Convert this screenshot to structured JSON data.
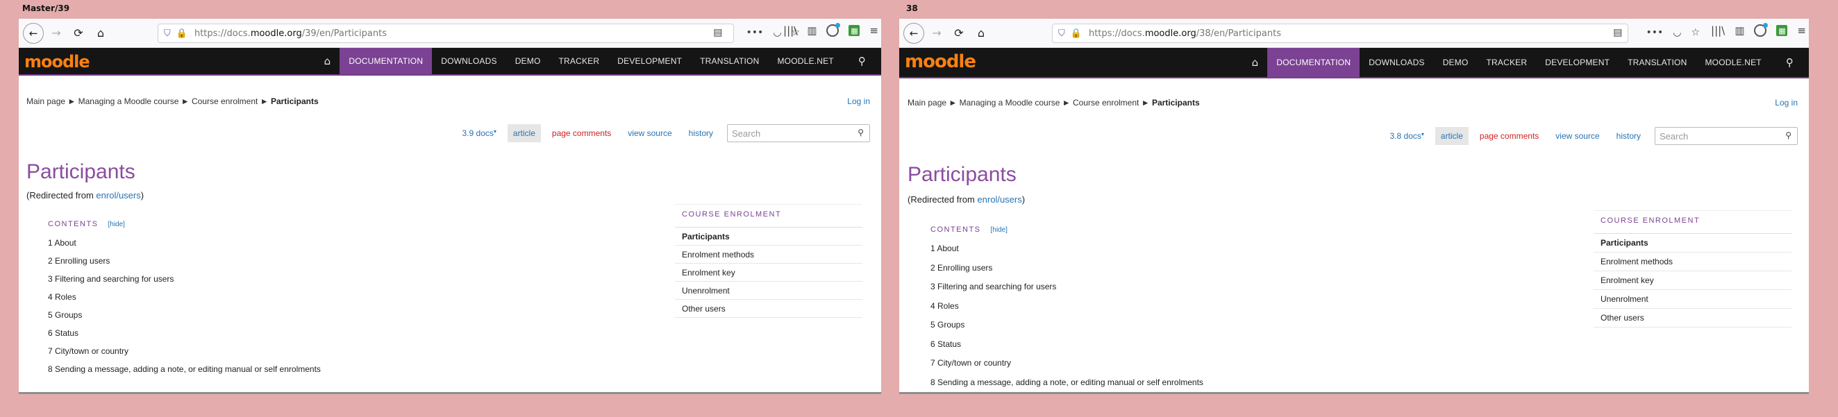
{
  "panels": [
    {
      "label": "Master/39",
      "url_prefix": "https://docs.",
      "url_domain": "moodle.org",
      "url_path": "/39/en/Participants",
      "version_label": "3.9 docs",
      "caret": "▾"
    },
    {
      "label": "38",
      "url_prefix": "https://docs.",
      "url_domain": "moodle.org",
      "url_path": "/38/en/Participants",
      "version_label": "3.8 docs",
      "caret": "▾"
    }
  ],
  "logo": "moodle",
  "nav": [
    "DOCUMENTATION",
    "DOWNLOADS",
    "DEMO",
    "TRACKER",
    "DEVELOPMENT",
    "TRANSLATION",
    "MOODLE.NET"
  ],
  "breadcrumb": {
    "main": "Main page",
    "sep": "►",
    "course": "Managing a Moodle course",
    "enrol": "Course enrolment",
    "current": "Participants"
  },
  "login": "Log in",
  "tabs": {
    "article": "article",
    "comments": "page comments",
    "source": "view source",
    "history": "history"
  },
  "search_placeholder": "Search",
  "page_title": "Participants",
  "redirect": {
    "prefix": "(Redirected from ",
    "link": "enrol/users",
    "suffix": ")"
  },
  "toc": {
    "heading": "CONTENTS",
    "hide": "[hide]",
    "items": [
      "1 About",
      "2 Enrolling users",
      "3 Filtering and searching for users",
      "4 Roles",
      "5 Groups",
      "6 Status",
      "7 City/town or country",
      "8 Sending a message, adding a note, or editing manual or self enrolments"
    ]
  },
  "sidebar": {
    "heading": "COURSE ENROLMENT",
    "items": [
      "Participants",
      "Enrolment methods",
      "Enrolment key",
      "Unenrolment",
      "Other users"
    ]
  },
  "icons": {
    "back": "←",
    "forward": "→",
    "reload": "⟳",
    "home": "⌂",
    "shield": "⛉",
    "lock": "🔒",
    "reader": "▤",
    "more": "•••",
    "pocket": "◡",
    "star": "☆",
    "library": "|||\\",
    "sidebar": "▥",
    "menu": "≡",
    "search": "⚲",
    "sheet": "▦"
  },
  "colors": {
    "accent": "#7b4293",
    "link": "#2673b3",
    "orange": "#f98012",
    "background": "#e4acac"
  }
}
